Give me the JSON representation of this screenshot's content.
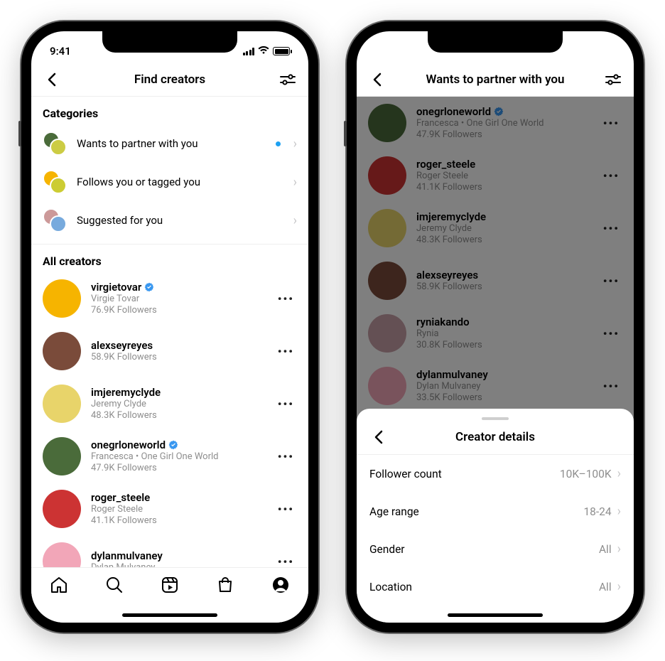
{
  "status": {
    "time": "9:41"
  },
  "phone1": {
    "title": "Find creators",
    "section_categories": "Categories",
    "section_all": "All creators",
    "categories": [
      {
        "label": "Wants to partner with you",
        "has_new": true
      },
      {
        "label": "Follows you or tagged you",
        "has_new": false
      },
      {
        "label": "Suggested for you",
        "has_new": false
      }
    ],
    "creators": [
      {
        "username": "virgietovar",
        "verified": true,
        "display_name": "Virgie Tovar",
        "followers": "76.9K Followers",
        "avatar_bg": "#f6b400"
      },
      {
        "username": "alexseyreyes",
        "verified": false,
        "display_name": "",
        "followers": "58.9K Followers",
        "avatar_bg": "#7a4b3a"
      },
      {
        "username": "imjeremyclyde",
        "verified": false,
        "display_name": "Jeremy Clyde",
        "followers": "48.3K Followers",
        "avatar_bg": "#e8d46a"
      },
      {
        "username": "onegrloneworld",
        "verified": true,
        "display_name": "Francesca • One Girl One World",
        "followers": "47.9K Followers",
        "avatar_bg": "#4a6b3a"
      },
      {
        "username": "roger_steele",
        "verified": false,
        "display_name": "Roger Steele",
        "followers": "41.1K Followers",
        "avatar_bg": "#c33"
      },
      {
        "username": "dylanmulvaney",
        "verified": false,
        "display_name": "Dylan Mulvaney",
        "followers": "",
        "avatar_bg": "#f2a6b8"
      }
    ]
  },
  "phone2": {
    "title": "Wants to partner with you",
    "creators": [
      {
        "username": "onegrloneworld",
        "verified": true,
        "display_name": "Francesca • One Girl One World",
        "followers": "47.9K Followers",
        "avatar_bg": "#4a6b3a"
      },
      {
        "username": "roger_steele",
        "verified": false,
        "display_name": "Roger Steele",
        "followers": "41.1K Followers",
        "avatar_bg": "#c33"
      },
      {
        "username": "imjeremyclyde",
        "verified": false,
        "display_name": "Jeremy Clyde",
        "followers": "48.3K Followers",
        "avatar_bg": "#e8d46a"
      },
      {
        "username": "alexseyreyes",
        "verified": false,
        "display_name": "",
        "followers": "58.9K Followers",
        "avatar_bg": "#7a4b3a"
      },
      {
        "username": "ryniakando",
        "verified": false,
        "display_name": "Rynia",
        "followers": "30.8K Followers",
        "avatar_bg": "#c9a0a8"
      },
      {
        "username": "dylanmulvaney",
        "verified": false,
        "display_name": "Dylan Mulvaney",
        "followers": "33.5K Followers",
        "avatar_bg": "#f2a6b8"
      }
    ],
    "sheet": {
      "title": "Creator details",
      "rows": [
        {
          "label": "Follower count",
          "value": "10K–100K"
        },
        {
          "label": "Age range",
          "value": "18-24"
        },
        {
          "label": "Gender",
          "value": "All"
        },
        {
          "label": "Location",
          "value": "All"
        }
      ]
    }
  }
}
